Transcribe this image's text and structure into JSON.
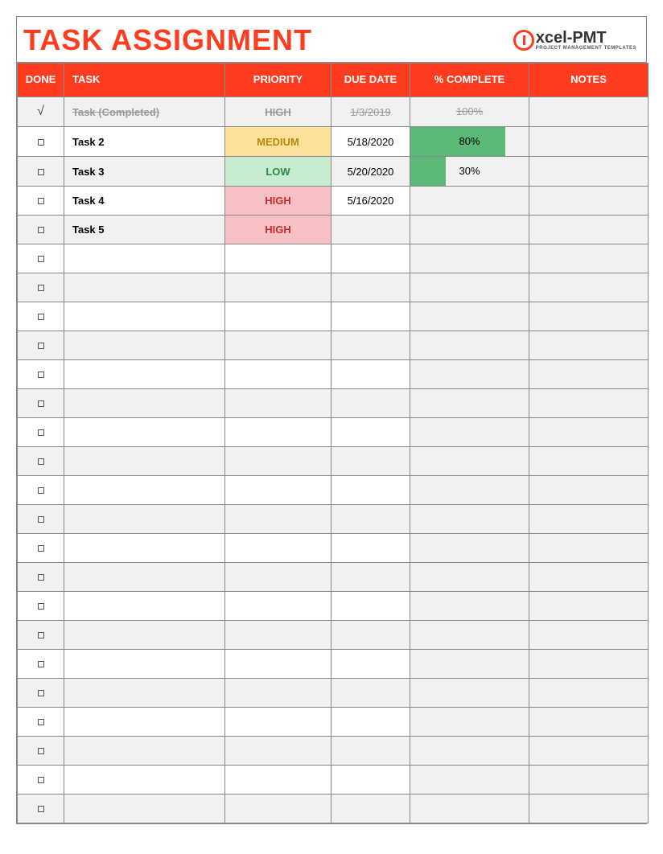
{
  "title": "TASK ASSIGNMENT",
  "logo": {
    "brand": "xcel-PMT",
    "tagline": "PROJECT MANAGEMENT TEMPLATES"
  },
  "columns": {
    "done": "DONE",
    "task": "TASK",
    "priority": "PRIORITY",
    "due": "DUE DATE",
    "pct": "% COMPLETE",
    "notes": "NOTES"
  },
  "rows": [
    {
      "done": true,
      "task": "Task (Completed)",
      "priority": "HIGH",
      "due": "1/3/2019",
      "pct": 100,
      "pct_label": "100%",
      "notes": "",
      "completed": true
    },
    {
      "done": false,
      "task": "Task 2",
      "priority": "MEDIUM",
      "due": "5/18/2020",
      "pct": 80,
      "pct_label": "80%",
      "notes": "",
      "completed": false
    },
    {
      "done": false,
      "task": "Task 3",
      "priority": "LOW",
      "due": "5/20/2020",
      "pct": 30,
      "pct_label": "30%",
      "notes": "",
      "completed": false
    },
    {
      "done": false,
      "task": "Task 4",
      "priority": "HIGH",
      "due": "5/16/2020",
      "pct": null,
      "pct_label": "",
      "notes": "",
      "completed": false
    },
    {
      "done": false,
      "task": "Task 5",
      "priority": "HIGH",
      "due": "",
      "pct": null,
      "pct_label": "",
      "notes": "",
      "completed": false
    }
  ],
  "empty_row_count": 20,
  "colors": {
    "accent": "#ff3c1f",
    "priority_high_bg": "#f6c0c4",
    "priority_medium_bg": "#ffe29a",
    "priority_low_bg": "#c8ecd0",
    "progress_bar": "#5ab974"
  }
}
